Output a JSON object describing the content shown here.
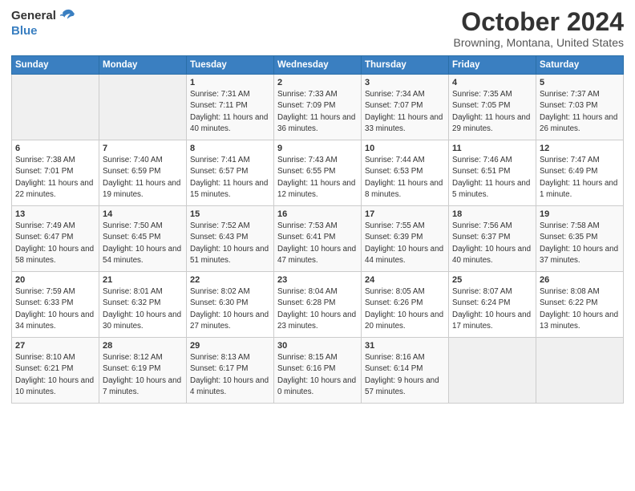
{
  "header": {
    "logo_general": "General",
    "logo_blue": "Blue",
    "month_title": "October 2024",
    "location": "Browning, Montana, United States"
  },
  "days_of_week": [
    "Sunday",
    "Monday",
    "Tuesday",
    "Wednesday",
    "Thursday",
    "Friday",
    "Saturday"
  ],
  "weeks": [
    [
      {
        "day": "",
        "info": ""
      },
      {
        "day": "",
        "info": ""
      },
      {
        "day": "1",
        "info": "Sunrise: 7:31 AM\nSunset: 7:11 PM\nDaylight: 11 hours and 40 minutes."
      },
      {
        "day": "2",
        "info": "Sunrise: 7:33 AM\nSunset: 7:09 PM\nDaylight: 11 hours and 36 minutes."
      },
      {
        "day": "3",
        "info": "Sunrise: 7:34 AM\nSunset: 7:07 PM\nDaylight: 11 hours and 33 minutes."
      },
      {
        "day": "4",
        "info": "Sunrise: 7:35 AM\nSunset: 7:05 PM\nDaylight: 11 hours and 29 minutes."
      },
      {
        "day": "5",
        "info": "Sunrise: 7:37 AM\nSunset: 7:03 PM\nDaylight: 11 hours and 26 minutes."
      }
    ],
    [
      {
        "day": "6",
        "info": "Sunrise: 7:38 AM\nSunset: 7:01 PM\nDaylight: 11 hours and 22 minutes."
      },
      {
        "day": "7",
        "info": "Sunrise: 7:40 AM\nSunset: 6:59 PM\nDaylight: 11 hours and 19 minutes."
      },
      {
        "day": "8",
        "info": "Sunrise: 7:41 AM\nSunset: 6:57 PM\nDaylight: 11 hours and 15 minutes."
      },
      {
        "day": "9",
        "info": "Sunrise: 7:43 AM\nSunset: 6:55 PM\nDaylight: 11 hours and 12 minutes."
      },
      {
        "day": "10",
        "info": "Sunrise: 7:44 AM\nSunset: 6:53 PM\nDaylight: 11 hours and 8 minutes."
      },
      {
        "day": "11",
        "info": "Sunrise: 7:46 AM\nSunset: 6:51 PM\nDaylight: 11 hours and 5 minutes."
      },
      {
        "day": "12",
        "info": "Sunrise: 7:47 AM\nSunset: 6:49 PM\nDaylight: 11 hours and 1 minute."
      }
    ],
    [
      {
        "day": "13",
        "info": "Sunrise: 7:49 AM\nSunset: 6:47 PM\nDaylight: 10 hours and 58 minutes."
      },
      {
        "day": "14",
        "info": "Sunrise: 7:50 AM\nSunset: 6:45 PM\nDaylight: 10 hours and 54 minutes."
      },
      {
        "day": "15",
        "info": "Sunrise: 7:52 AM\nSunset: 6:43 PM\nDaylight: 10 hours and 51 minutes."
      },
      {
        "day": "16",
        "info": "Sunrise: 7:53 AM\nSunset: 6:41 PM\nDaylight: 10 hours and 47 minutes."
      },
      {
        "day": "17",
        "info": "Sunrise: 7:55 AM\nSunset: 6:39 PM\nDaylight: 10 hours and 44 minutes."
      },
      {
        "day": "18",
        "info": "Sunrise: 7:56 AM\nSunset: 6:37 PM\nDaylight: 10 hours and 40 minutes."
      },
      {
        "day": "19",
        "info": "Sunrise: 7:58 AM\nSunset: 6:35 PM\nDaylight: 10 hours and 37 minutes."
      }
    ],
    [
      {
        "day": "20",
        "info": "Sunrise: 7:59 AM\nSunset: 6:33 PM\nDaylight: 10 hours and 34 minutes."
      },
      {
        "day": "21",
        "info": "Sunrise: 8:01 AM\nSunset: 6:32 PM\nDaylight: 10 hours and 30 minutes."
      },
      {
        "day": "22",
        "info": "Sunrise: 8:02 AM\nSunset: 6:30 PM\nDaylight: 10 hours and 27 minutes."
      },
      {
        "day": "23",
        "info": "Sunrise: 8:04 AM\nSunset: 6:28 PM\nDaylight: 10 hours and 23 minutes."
      },
      {
        "day": "24",
        "info": "Sunrise: 8:05 AM\nSunset: 6:26 PM\nDaylight: 10 hours and 20 minutes."
      },
      {
        "day": "25",
        "info": "Sunrise: 8:07 AM\nSunset: 6:24 PM\nDaylight: 10 hours and 17 minutes."
      },
      {
        "day": "26",
        "info": "Sunrise: 8:08 AM\nSunset: 6:22 PM\nDaylight: 10 hours and 13 minutes."
      }
    ],
    [
      {
        "day": "27",
        "info": "Sunrise: 8:10 AM\nSunset: 6:21 PM\nDaylight: 10 hours and 10 minutes."
      },
      {
        "day": "28",
        "info": "Sunrise: 8:12 AM\nSunset: 6:19 PM\nDaylight: 10 hours and 7 minutes."
      },
      {
        "day": "29",
        "info": "Sunrise: 8:13 AM\nSunset: 6:17 PM\nDaylight: 10 hours and 4 minutes."
      },
      {
        "day": "30",
        "info": "Sunrise: 8:15 AM\nSunset: 6:16 PM\nDaylight: 10 hours and 0 minutes."
      },
      {
        "day": "31",
        "info": "Sunrise: 8:16 AM\nSunset: 6:14 PM\nDaylight: 9 hours and 57 minutes."
      },
      {
        "day": "",
        "info": ""
      },
      {
        "day": "",
        "info": ""
      }
    ]
  ]
}
